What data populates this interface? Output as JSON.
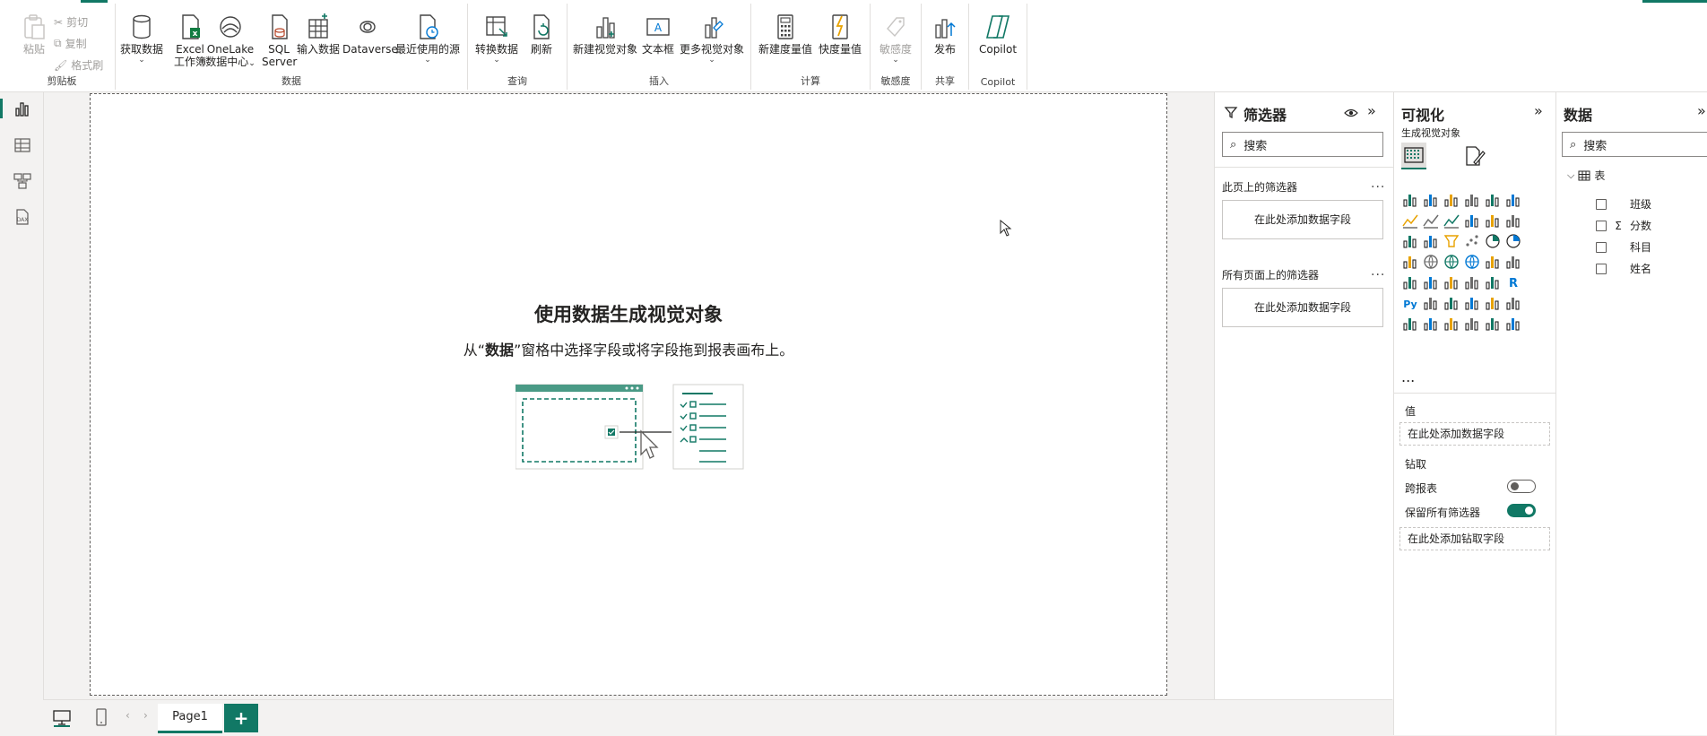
{
  "ribbon": {
    "clipboard": {
      "paste": "粘贴",
      "cut": "剪切",
      "copy": "复制",
      "format_painter": "格式刷",
      "group_label": "剪贴板"
    },
    "data": {
      "get_data": "获取数据",
      "excel_line1": "Excel",
      "excel_line2": "工作簿",
      "onelake_line1": "OneLake",
      "onelake_line2": "数据中心",
      "sql_line1": "SQL",
      "sql_line2": "Server",
      "enter_data": "输入数据",
      "dataverse": "Dataverse",
      "recent_sources": "最近使用的源",
      "group_label": "数据"
    },
    "query": {
      "transform": "转换数据",
      "refresh": "刷新",
      "group_label": "查询"
    },
    "insert": {
      "new_visual": "新建视觉对象",
      "text_box": "文本框",
      "more_visuals": "更多视觉对象",
      "group_label": "插入"
    },
    "calculations": {
      "new_measure": "新建度量值",
      "quick_measure": "快度量值",
      "group_label": "计算"
    },
    "sensitivity": {
      "label": "敏感度",
      "group_label": "敏感度"
    },
    "share": {
      "publish": "发布",
      "group_label": "共享"
    },
    "copilot": {
      "label": "Copilot",
      "group_label": "Copilot"
    }
  },
  "canvas": {
    "empty_title": "使用数据生成视觉对象",
    "empty_sub_prefix": "从“",
    "empty_sub_bold": "数据",
    "empty_sub_suffix": "”窗格中选择字段或将字段拖到报表画布上。"
  },
  "bottombar": {
    "page_tab": "Page1",
    "add_page": "+"
  },
  "filters": {
    "title": "筛选器",
    "search_placeholder": "搜索",
    "on_page": "此页上的筛选器",
    "on_all_pages": "所有页面上的筛选器",
    "add_field": "在此处添加数据字段",
    "ellipsis": "..."
  },
  "viz": {
    "title": "可视化",
    "build_visual": "生成视觉对象",
    "more": "...",
    "values_label": "值",
    "values_drop": "在此处添加数据字段",
    "drill_label": "钻取",
    "cross_report": "跨报表",
    "keep_filters": "保留所有筛选器",
    "drill_drop": "在此处添加钻取字段",
    "cross_report_on": false,
    "keep_filters_on": true,
    "accent": "#117865"
  },
  "datapane": {
    "title": "数据",
    "search_placeholder": "搜索",
    "table": "表",
    "fields": [
      {
        "name": "班级",
        "sigma": false
      },
      {
        "name": "分数",
        "sigma": true
      },
      {
        "name": "科目",
        "sigma": false
      },
      {
        "name": "姓名",
        "sigma": false
      }
    ]
  }
}
